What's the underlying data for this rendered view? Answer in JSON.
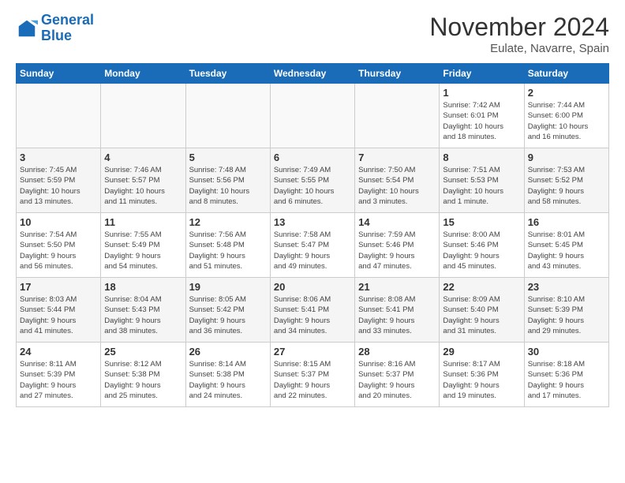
{
  "header": {
    "logo_line1": "General",
    "logo_line2": "Blue",
    "month_title": "November 2024",
    "location": "Eulate, Navarre, Spain"
  },
  "weekdays": [
    "Sunday",
    "Monday",
    "Tuesday",
    "Wednesday",
    "Thursday",
    "Friday",
    "Saturday"
  ],
  "weeks": [
    [
      {
        "day": "",
        "info": ""
      },
      {
        "day": "",
        "info": ""
      },
      {
        "day": "",
        "info": ""
      },
      {
        "day": "",
        "info": ""
      },
      {
        "day": "",
        "info": ""
      },
      {
        "day": "1",
        "info": "Sunrise: 7:42 AM\nSunset: 6:01 PM\nDaylight: 10 hours\nand 18 minutes."
      },
      {
        "day": "2",
        "info": "Sunrise: 7:44 AM\nSunset: 6:00 PM\nDaylight: 10 hours\nand 16 minutes."
      }
    ],
    [
      {
        "day": "3",
        "info": "Sunrise: 7:45 AM\nSunset: 5:59 PM\nDaylight: 10 hours\nand 13 minutes."
      },
      {
        "day": "4",
        "info": "Sunrise: 7:46 AM\nSunset: 5:57 PM\nDaylight: 10 hours\nand 11 minutes."
      },
      {
        "day": "5",
        "info": "Sunrise: 7:48 AM\nSunset: 5:56 PM\nDaylight: 10 hours\nand 8 minutes."
      },
      {
        "day": "6",
        "info": "Sunrise: 7:49 AM\nSunset: 5:55 PM\nDaylight: 10 hours\nand 6 minutes."
      },
      {
        "day": "7",
        "info": "Sunrise: 7:50 AM\nSunset: 5:54 PM\nDaylight: 10 hours\nand 3 minutes."
      },
      {
        "day": "8",
        "info": "Sunrise: 7:51 AM\nSunset: 5:53 PM\nDaylight: 10 hours\nand 1 minute."
      },
      {
        "day": "9",
        "info": "Sunrise: 7:53 AM\nSunset: 5:52 PM\nDaylight: 9 hours\nand 58 minutes."
      }
    ],
    [
      {
        "day": "10",
        "info": "Sunrise: 7:54 AM\nSunset: 5:50 PM\nDaylight: 9 hours\nand 56 minutes."
      },
      {
        "day": "11",
        "info": "Sunrise: 7:55 AM\nSunset: 5:49 PM\nDaylight: 9 hours\nand 54 minutes."
      },
      {
        "day": "12",
        "info": "Sunrise: 7:56 AM\nSunset: 5:48 PM\nDaylight: 9 hours\nand 51 minutes."
      },
      {
        "day": "13",
        "info": "Sunrise: 7:58 AM\nSunset: 5:47 PM\nDaylight: 9 hours\nand 49 minutes."
      },
      {
        "day": "14",
        "info": "Sunrise: 7:59 AM\nSunset: 5:46 PM\nDaylight: 9 hours\nand 47 minutes."
      },
      {
        "day": "15",
        "info": "Sunrise: 8:00 AM\nSunset: 5:46 PM\nDaylight: 9 hours\nand 45 minutes."
      },
      {
        "day": "16",
        "info": "Sunrise: 8:01 AM\nSunset: 5:45 PM\nDaylight: 9 hours\nand 43 minutes."
      }
    ],
    [
      {
        "day": "17",
        "info": "Sunrise: 8:03 AM\nSunset: 5:44 PM\nDaylight: 9 hours\nand 41 minutes."
      },
      {
        "day": "18",
        "info": "Sunrise: 8:04 AM\nSunset: 5:43 PM\nDaylight: 9 hours\nand 38 minutes."
      },
      {
        "day": "19",
        "info": "Sunrise: 8:05 AM\nSunset: 5:42 PM\nDaylight: 9 hours\nand 36 minutes."
      },
      {
        "day": "20",
        "info": "Sunrise: 8:06 AM\nSunset: 5:41 PM\nDaylight: 9 hours\nand 34 minutes."
      },
      {
        "day": "21",
        "info": "Sunrise: 8:08 AM\nSunset: 5:41 PM\nDaylight: 9 hours\nand 33 minutes."
      },
      {
        "day": "22",
        "info": "Sunrise: 8:09 AM\nSunset: 5:40 PM\nDaylight: 9 hours\nand 31 minutes."
      },
      {
        "day": "23",
        "info": "Sunrise: 8:10 AM\nSunset: 5:39 PM\nDaylight: 9 hours\nand 29 minutes."
      }
    ],
    [
      {
        "day": "24",
        "info": "Sunrise: 8:11 AM\nSunset: 5:39 PM\nDaylight: 9 hours\nand 27 minutes."
      },
      {
        "day": "25",
        "info": "Sunrise: 8:12 AM\nSunset: 5:38 PM\nDaylight: 9 hours\nand 25 minutes."
      },
      {
        "day": "26",
        "info": "Sunrise: 8:14 AM\nSunset: 5:38 PM\nDaylight: 9 hours\nand 24 minutes."
      },
      {
        "day": "27",
        "info": "Sunrise: 8:15 AM\nSunset: 5:37 PM\nDaylight: 9 hours\nand 22 minutes."
      },
      {
        "day": "28",
        "info": "Sunrise: 8:16 AM\nSunset: 5:37 PM\nDaylight: 9 hours\nand 20 minutes."
      },
      {
        "day": "29",
        "info": "Sunrise: 8:17 AM\nSunset: 5:36 PM\nDaylight: 9 hours\nand 19 minutes."
      },
      {
        "day": "30",
        "info": "Sunrise: 8:18 AM\nSunset: 5:36 PM\nDaylight: 9 hours\nand 17 minutes."
      }
    ]
  ]
}
